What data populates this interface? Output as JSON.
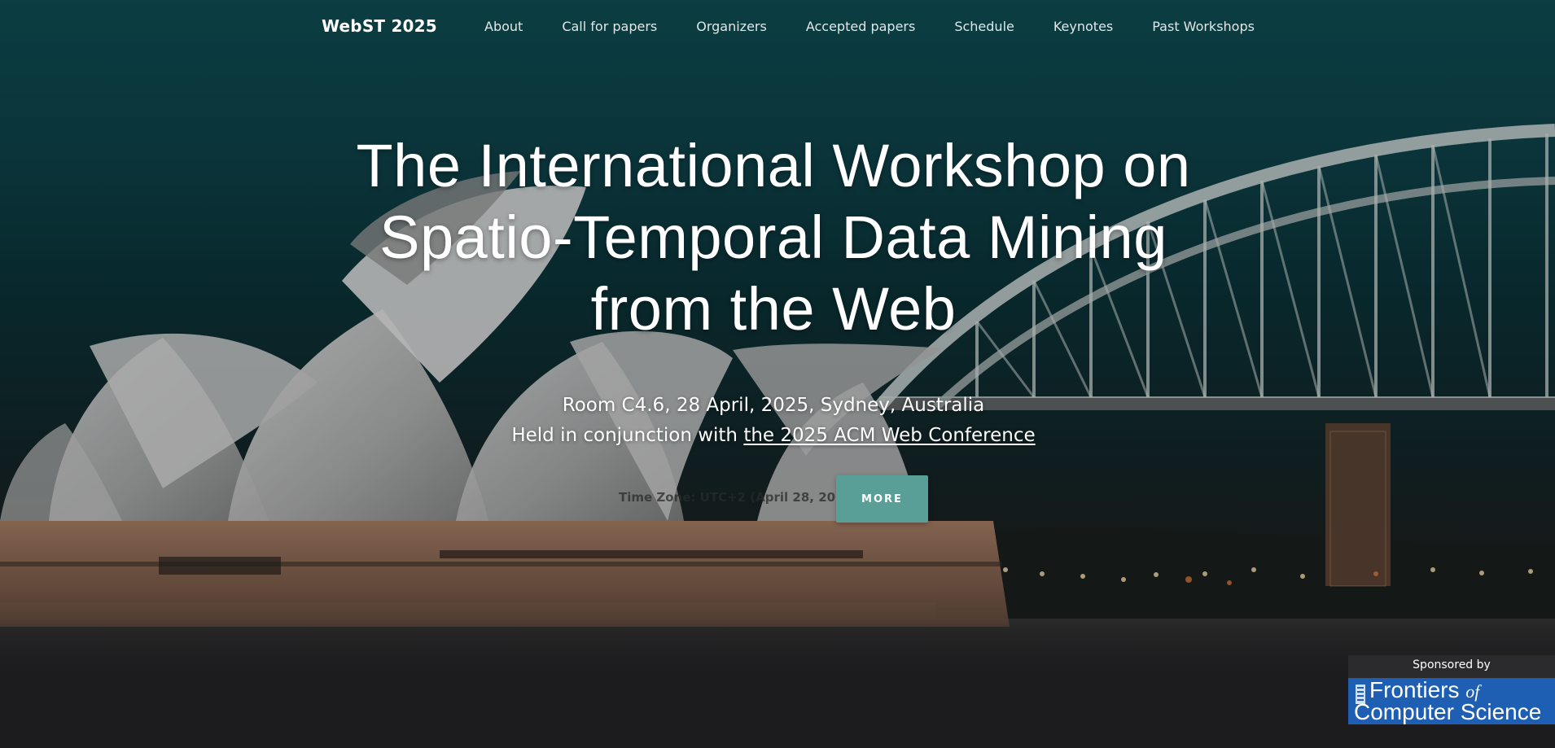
{
  "navbar": {
    "brand": "WebST 2025",
    "links": [
      {
        "label": "About"
      },
      {
        "label": "Call for papers"
      },
      {
        "label": "Organizers"
      },
      {
        "label": "Accepted papers"
      },
      {
        "label": "Schedule"
      },
      {
        "label": "Keynotes"
      },
      {
        "label": "Past Workshops"
      }
    ]
  },
  "hero": {
    "title_lines": [
      "The International Workshop on",
      "Spatio-Temporal Data Mining",
      "from the Web"
    ],
    "location_line": "Room C4.6, 28 April, 2025, Sydney, Australia",
    "conjunction_prefix": "Held in conjunction with ",
    "conjunction_link": "the 2025 ACM Web Conference",
    "timezone": "Time Zone: UTC+2 (April 28, 2025)",
    "more_button": "MORE"
  },
  "sponsor": {
    "label": "Sponsored by",
    "logo_line1_main": "Frontiers",
    "logo_line1_of": "of",
    "logo_line2": "Computer Science"
  },
  "colors": {
    "accent_button": "#5a9e98",
    "sponsor_logo_bg": "#1e5fb4",
    "sky_teal": "#0f4f55",
    "dark_bottom": "#1c1c1e"
  },
  "icons": {
    "logo_mark": "frontiers-logo-icon"
  }
}
